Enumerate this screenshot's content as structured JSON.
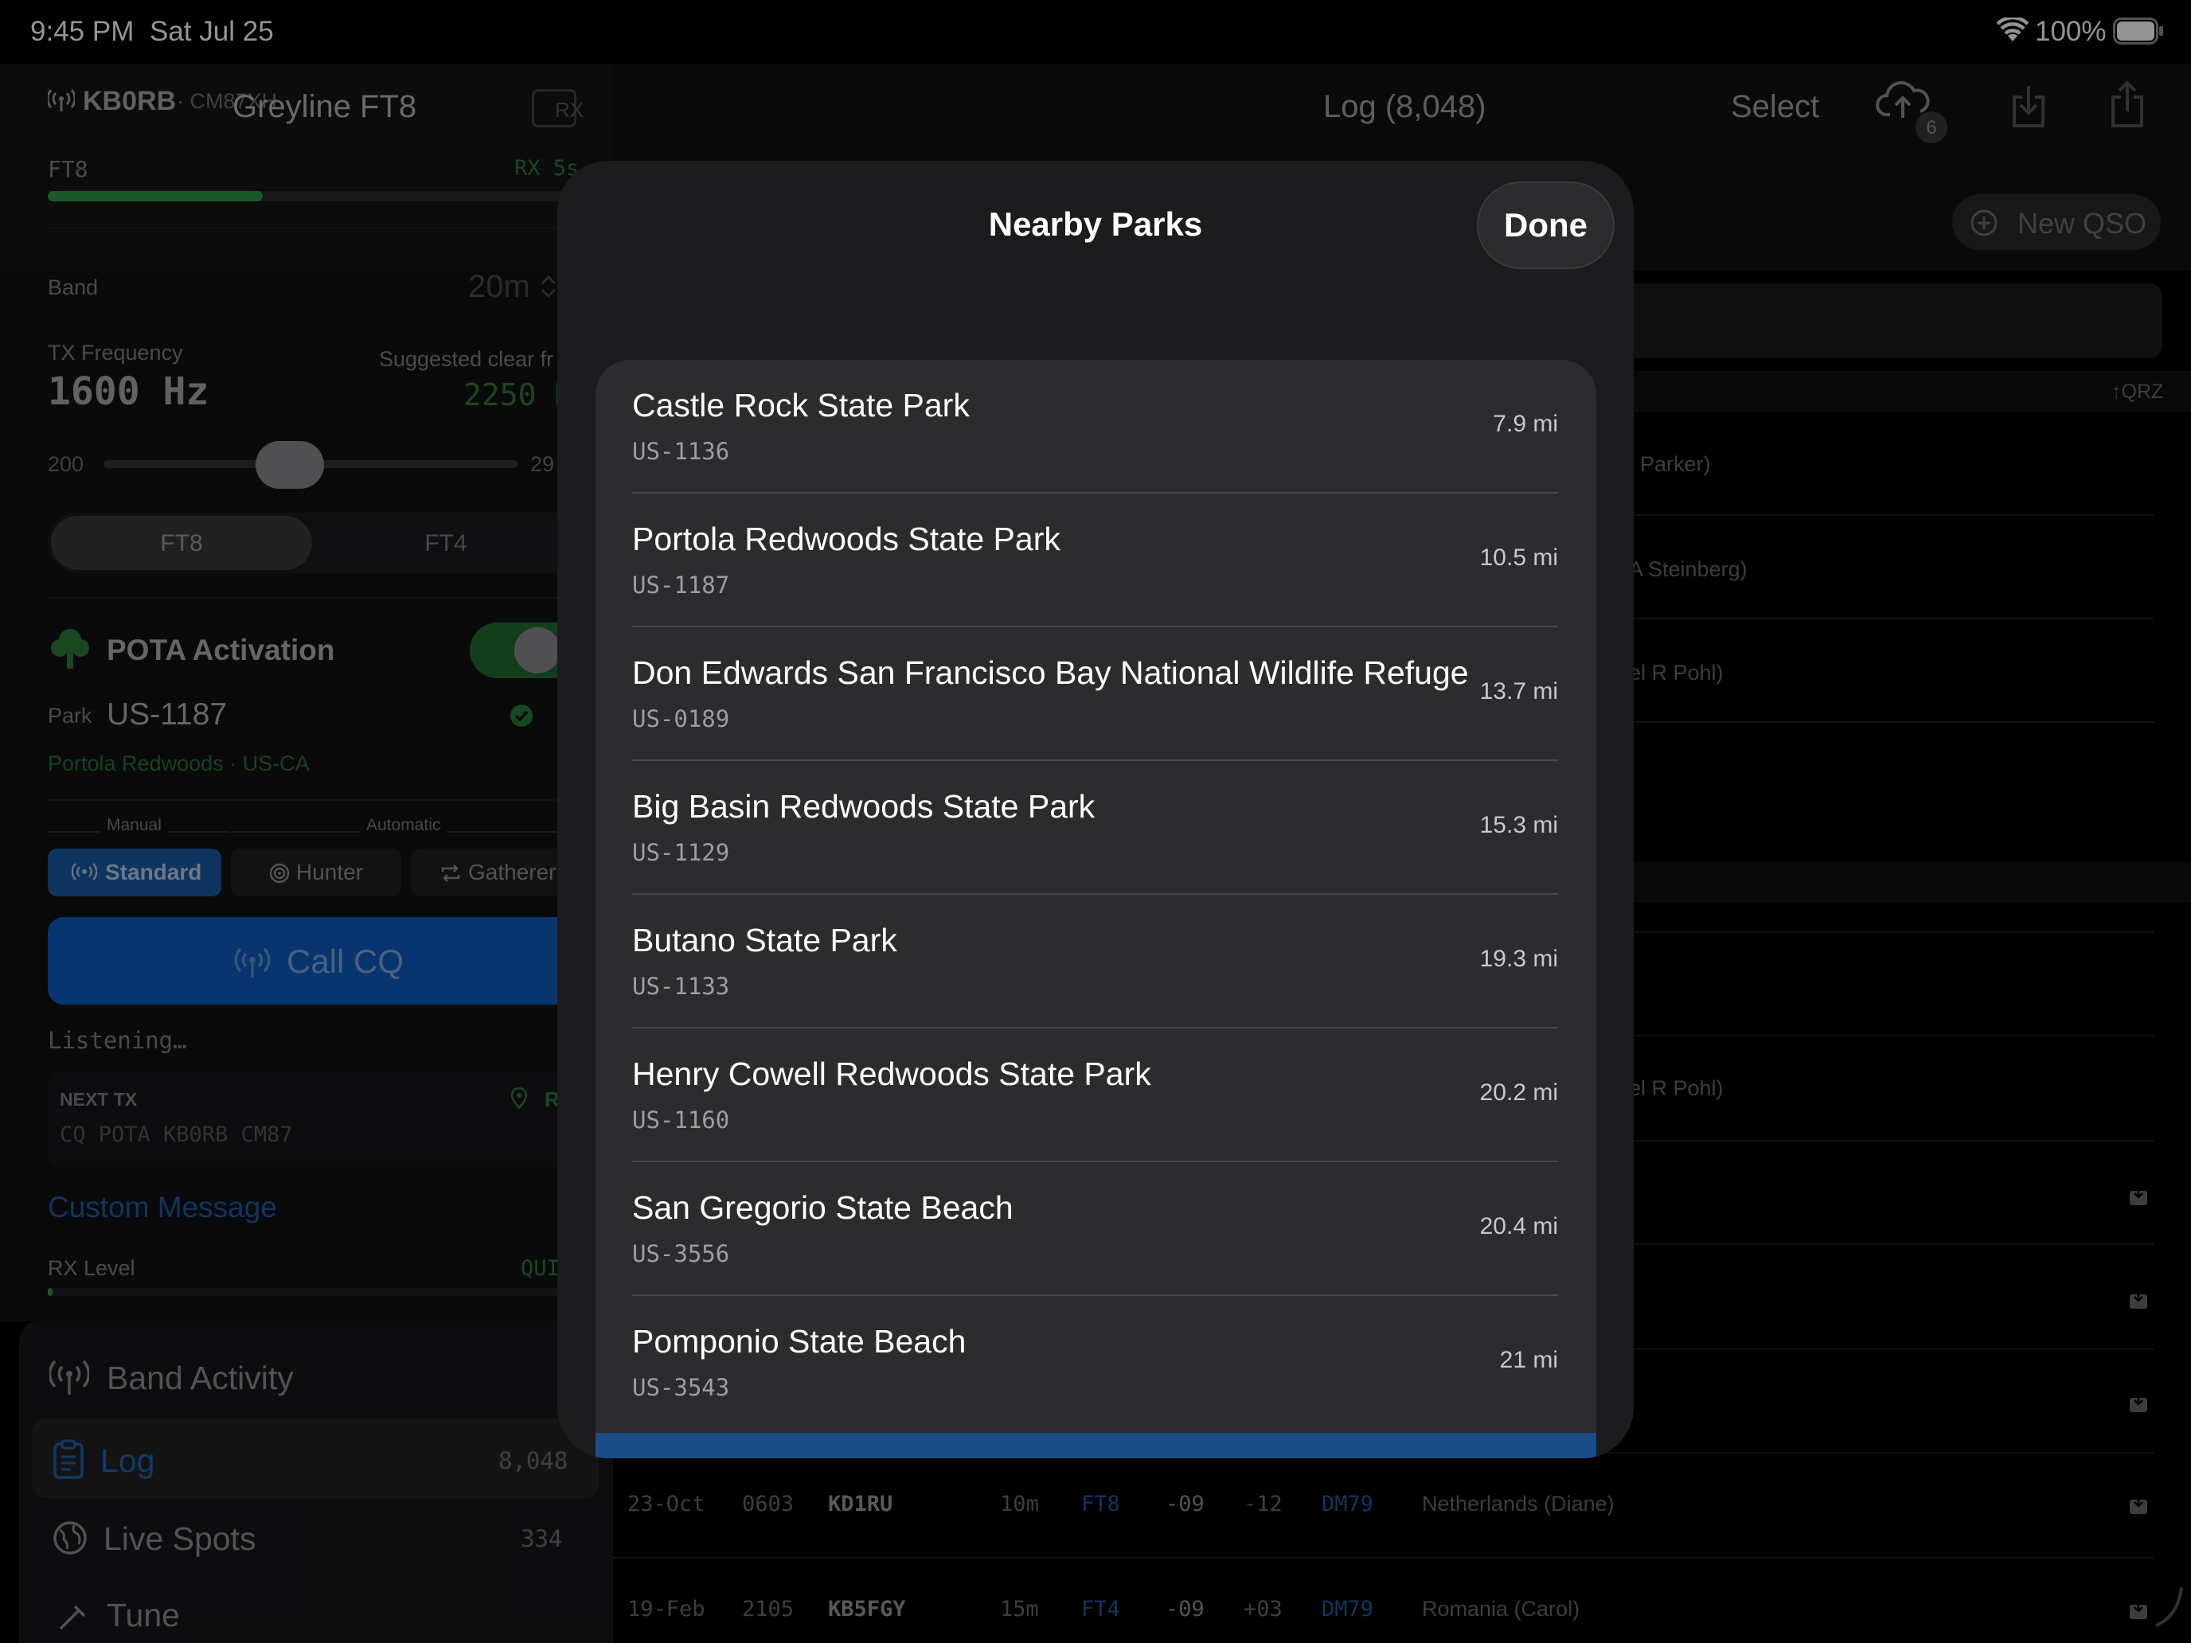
{
  "status_bar": {
    "time": "9:45 PM",
    "date": "Sat Jul 25",
    "battery": "100%"
  },
  "left": {
    "callsign": "KB0RB",
    "grid_partial": "· CM87XH",
    "app_title": "Greyline FT8",
    "rx_badge": "RX",
    "mode": "FT8",
    "rx_countdown": "RX 5s",
    "rx_progress": 0.38,
    "band_label": "Band",
    "band_value": "20m",
    "tx_freq_label": "TX Frequency",
    "tx_freq_value": "1600 Hz",
    "suggested_label": "Suggested clear fr",
    "suggested_value": "2250 H",
    "slider_min": "200",
    "slider_max": "29",
    "slider_fraction": 0.45,
    "mode_seg": [
      "FT8",
      "FT4"
    ],
    "pota_title": "POTA Activation",
    "park_label": "Park",
    "park_value": "US-1187",
    "park_desc": "Portola Redwoods · US-CA",
    "manual_label": "Manual",
    "automatic_label": "Automatic",
    "strategy_buttons": [
      "Standard",
      "Hunter",
      "Gatherer"
    ],
    "call_cq": "Call CQ",
    "listening": "Listening…",
    "next_tx_label": "NEXT TX",
    "next_tx_r": "R",
    "next_tx_msg": "CQ POTA KB0RB CM87",
    "custom_message": "Custom Message",
    "rx_level_label": "RX Level",
    "rx_level_status": "QUI",
    "nav": [
      {
        "label": "Band Activity",
        "count": ""
      },
      {
        "label": "Log",
        "count": "8,048"
      },
      {
        "label": "Live Spots",
        "count": "334"
      },
      {
        "label": "Tune",
        "count": ""
      }
    ]
  },
  "right": {
    "title": "Log (8,048)",
    "select": "Select",
    "upload_badge": "6",
    "new_qso": "New QSO",
    "qrz_sort": "↑QRZ",
    "partial_names": [
      "Parker)",
      "A Steinberg)",
      "el R Pohl)",
      "el R Pohl)"
    ],
    "rows": [
      {
        "date": "23-Oct",
        "time": "0603",
        "call": "KD1RU",
        "band": "10m",
        "mode": "FT8",
        "sent": "-09",
        "rcvd": "-12",
        "grid": "DM79",
        "name": "Netherlands (Diane)"
      },
      {
        "date": "19-Feb",
        "time": "2105",
        "call": "KB5FGY",
        "band": "15m",
        "mode": "FT4",
        "sent": "-09",
        "rcvd": "+03",
        "grid": "DM79",
        "name": "Romania (Carol)"
      }
    ]
  },
  "modal": {
    "title": "Nearby Parks",
    "done": "Done",
    "parks": [
      {
        "name": "Castle Rock State Park",
        "ref": "US-1136",
        "dist": "7.9 mi"
      },
      {
        "name": "Portola Redwoods State Park",
        "ref": "US-1187",
        "dist": "10.5 mi"
      },
      {
        "name": "Don Edwards San Francisco Bay National Wildlife Refuge",
        "ref": "US-0189",
        "dist": "13.7 mi"
      },
      {
        "name": "Big Basin Redwoods State Park",
        "ref": "US-1129",
        "dist": "15.3 mi"
      },
      {
        "name": "Butano State Park",
        "ref": "US-1133",
        "dist": "19.3 mi"
      },
      {
        "name": "Henry Cowell Redwoods State Park",
        "ref": "US-1160",
        "dist": "20.2 mi"
      },
      {
        "name": "San Gregorio State Beach",
        "ref": "US-3556",
        "dist": "20.4 mi"
      },
      {
        "name": "Pomponio State Beach",
        "ref": "US-3543",
        "dist": "21 mi"
      }
    ]
  },
  "colors": {
    "accent_blue": "#0a84ff",
    "green": "#30d158",
    "modal_bg": "#1c1c1e",
    "card_bg": "#2c2c2e"
  }
}
